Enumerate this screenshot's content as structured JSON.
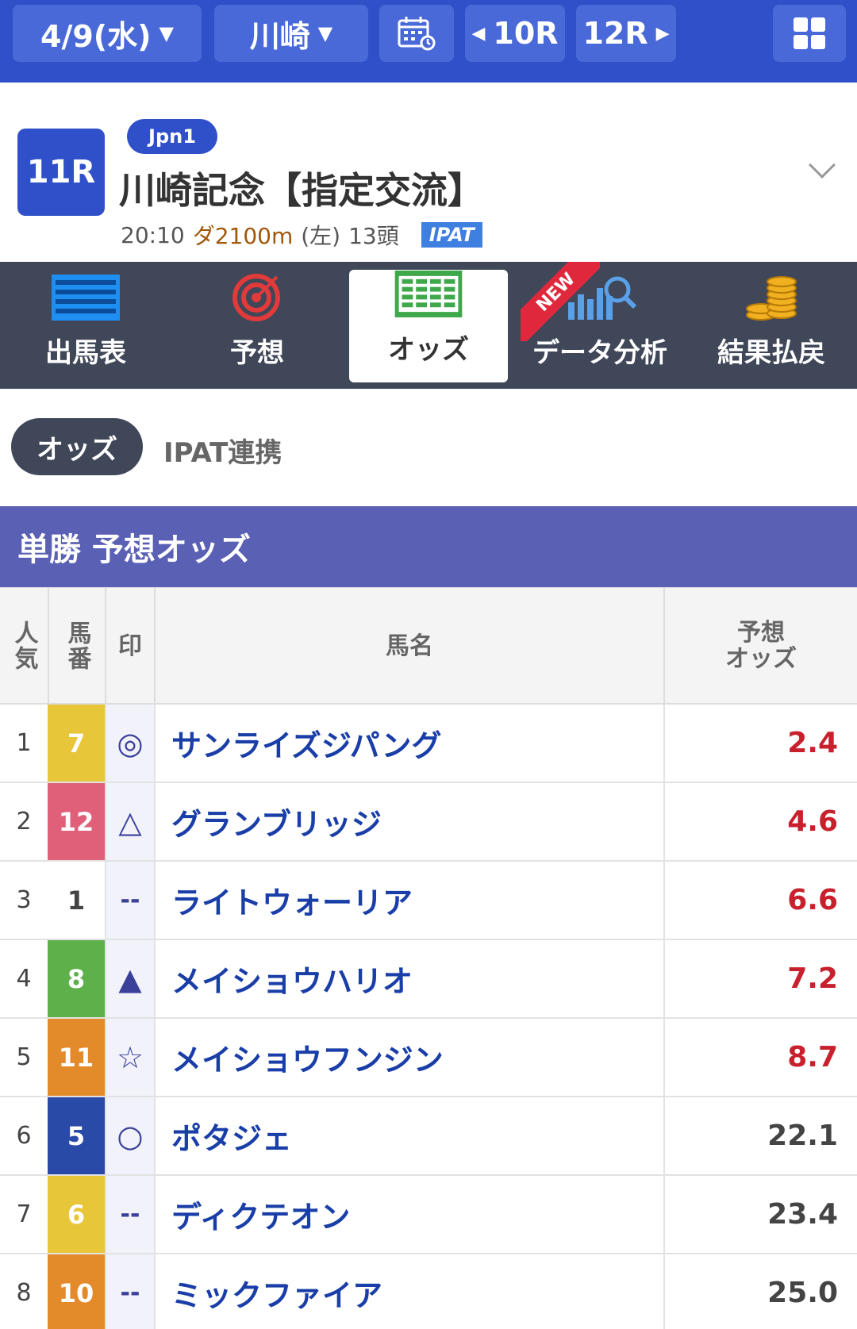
{
  "topbar": {
    "date": "4/9(水)",
    "venue": "川崎",
    "prev_race": "10R",
    "next_race": "12R"
  },
  "race": {
    "number": "11R",
    "grade": "Jpn1",
    "title": "川崎記念【指定交流】",
    "time": "20:10",
    "distance": "ダ2100m",
    "direction": "(左)",
    "runners": "13頭",
    "ipat": "IPAT"
  },
  "tabs": [
    {
      "label": "出馬表",
      "icon": "entries-table-icon"
    },
    {
      "label": "予想",
      "icon": "target-icon"
    },
    {
      "label": "オッズ",
      "icon": "odds-sheet-icon"
    },
    {
      "label": "データ分析",
      "icon": "chart-magnifier-icon"
    },
    {
      "label": "結果払戻",
      "icon": "coins-icon"
    }
  ],
  "new_badge": "NEW",
  "subtabs": {
    "active": "オッズ",
    "other": "IPAT連携"
  },
  "section_title": "単勝 予想オッズ",
  "table": {
    "headers": {
      "rank": "人気",
      "num": "馬番",
      "mark": "印",
      "name": "馬名",
      "odds_line1": "予想",
      "odds_line2": "オッズ"
    },
    "rows": [
      {
        "rank": "1",
        "num": "7",
        "color": "#e8c63a",
        "mark": "◎",
        "name": "サンライズジパング",
        "odds": "2.4",
        "hot": true
      },
      {
        "rank": "2",
        "num": "12",
        "color": "#e0607a",
        "mark": "△",
        "name": "グランブリッジ",
        "odds": "4.6",
        "hot": true
      },
      {
        "rank": "3",
        "num": "1",
        "color": "#ffffff",
        "mark": "--",
        "name": "ライトウォーリア",
        "odds": "6.6",
        "hot": true
      },
      {
        "rank": "4",
        "num": "8",
        "color": "#5db04a",
        "mark": "▲",
        "name": "メイショウハリオ",
        "odds": "7.2",
        "hot": true
      },
      {
        "rank": "5",
        "num": "11",
        "color": "#e38a2a",
        "mark": "☆",
        "name": "メイショウフンジン",
        "odds": "8.7",
        "hot": true
      },
      {
        "rank": "6",
        "num": "5",
        "color": "#2a4aa8",
        "mark": "○",
        "name": "ポタジェ",
        "odds": "22.1",
        "hot": false
      },
      {
        "rank": "7",
        "num": "6",
        "color": "#e8c63a",
        "mark": "--",
        "name": "ディクテオン",
        "odds": "23.4",
        "hot": false
      },
      {
        "rank": "8",
        "num": "10",
        "color": "#e38a2a",
        "mark": "--",
        "name": "ミックファイア",
        "odds": "25.0",
        "hot": false
      }
    ]
  }
}
